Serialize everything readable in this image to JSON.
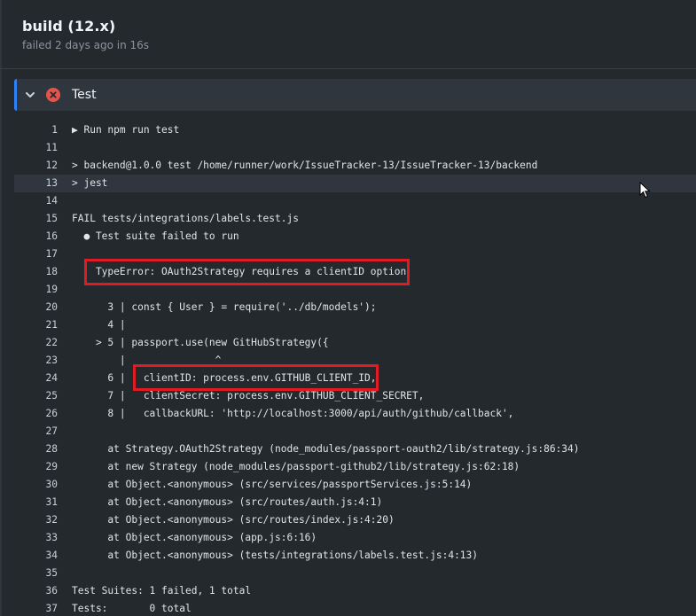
{
  "header": {
    "title": "build (12.x)",
    "subtitle": "failed 2 days ago in 16s"
  },
  "step": {
    "name": "Test",
    "status": "failed",
    "chevron_icon": "chevron-down-icon",
    "status_icon": "x-circle-icon"
  },
  "log": [
    {
      "n": "1",
      "t": "▶ Run npm run test"
    },
    {
      "n": "11",
      "t": ""
    },
    {
      "n": "12",
      "t": "> backend@1.0.0 test /home/runner/work/IssueTracker-13/IssueTracker-13/backend"
    },
    {
      "n": "13",
      "t": "> jest"
    },
    {
      "n": "14",
      "t": ""
    },
    {
      "n": "15",
      "t": "FAIL tests/integrations/labels.test.js"
    },
    {
      "n": "16",
      "t": "  ● Test suite failed to run"
    },
    {
      "n": "17",
      "t": ""
    },
    {
      "n": "18",
      "t": "    TypeError: OAuth2Strategy requires a clientID option"
    },
    {
      "n": "19",
      "t": ""
    },
    {
      "n": "20",
      "t": "      3 | const { User } = require('../db/models');"
    },
    {
      "n": "21",
      "t": "      4 |"
    },
    {
      "n": "22",
      "t": "    > 5 | passport.use(new GitHubStrategy({"
    },
    {
      "n": "23",
      "t": "        |               ^"
    },
    {
      "n": "24",
      "t": "      6 |   clientID: process.env.GITHUB_CLIENT_ID,"
    },
    {
      "n": "25",
      "t": "      7 |   clientSecret: process.env.GITHUB_CLIENT_SECRET,"
    },
    {
      "n": "26",
      "t": "      8 |   callbackURL: 'http://localhost:3000/api/auth/github/callback',"
    },
    {
      "n": "27",
      "t": ""
    },
    {
      "n": "28",
      "t": "      at Strategy.OAuth2Strategy (node_modules/passport-oauth2/lib/strategy.js:86:34)"
    },
    {
      "n": "29",
      "t": "      at new Strategy (node_modules/passport-github2/lib/strategy.js:62:18)"
    },
    {
      "n": "30",
      "t": "      at Object.<anonymous> (src/services/passportServices.js:5:14)"
    },
    {
      "n": "31",
      "t": "      at Object.<anonymous> (src/routes/auth.js:4:1)"
    },
    {
      "n": "32",
      "t": "      at Object.<anonymous> (src/routes/index.js:4:20)"
    },
    {
      "n": "33",
      "t": "      at Object.<anonymous> (app.js:6:16)"
    },
    {
      "n": "34",
      "t": "      at Object.<anonymous> (tests/integrations/labels.test.js:4:13)"
    },
    {
      "n": "35",
      "t": ""
    },
    {
      "n": "36",
      "t": "Test Suites: 1 failed, 1 total"
    },
    {
      "n": "37",
      "t": "Tests:       0 total"
    }
  ],
  "highlighted_line": "13",
  "annotations": {
    "color": "#e01b24"
  }
}
